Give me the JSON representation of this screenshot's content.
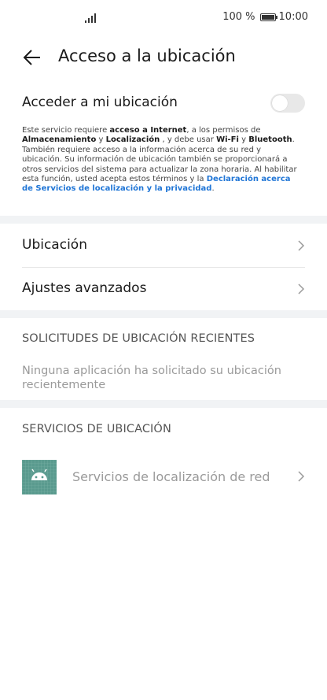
{
  "status_bar": {
    "battery": "100 %",
    "time": "10:00"
  },
  "header": {
    "title": "Acceso a la ubicación"
  },
  "access": {
    "label": "Acceder a mi ubicación",
    "enabled": false,
    "desc": {
      "p1": "Este servicio requiere ",
      "b1": "acceso a Internet",
      "p2": ", a los permisos de ",
      "b2": "Almacenamiento",
      "p3": " y ",
      "b3": "Localización",
      "p4": " , y debe usar ",
      "b4": "Wi-Fi",
      "p5": " y ",
      "b5": "Bluetooth",
      "p6": ". También requiere acceso a la información acerca de su red y ubicación. Su información de ubicación también se proporcionará a otros servicios del sistema para actualizar la zona horaria. Al habilitar esta función, usted acepta estos términos y la ",
      "link": "Declaración acerca de Servicios de localización y la privacidad",
      "p7": "."
    }
  },
  "menu": {
    "location": "Ubicación",
    "advanced": "Ajustes avanzados"
  },
  "recent": {
    "title": "SOLICITUDES DE UBICACIÓN RECIENTES",
    "empty": "Ninguna aplicación ha solicitado su ubicación recientemente"
  },
  "services": {
    "title": "SERVICIOS DE UBICACIÓN",
    "items": [
      {
        "label": "Servicios de localización de red",
        "icon": "android-icon"
      }
    ]
  },
  "colors": {
    "accent": "#1f75d6",
    "band": "#f1f3f5",
    "icon_bg": "#5a9a8e"
  }
}
